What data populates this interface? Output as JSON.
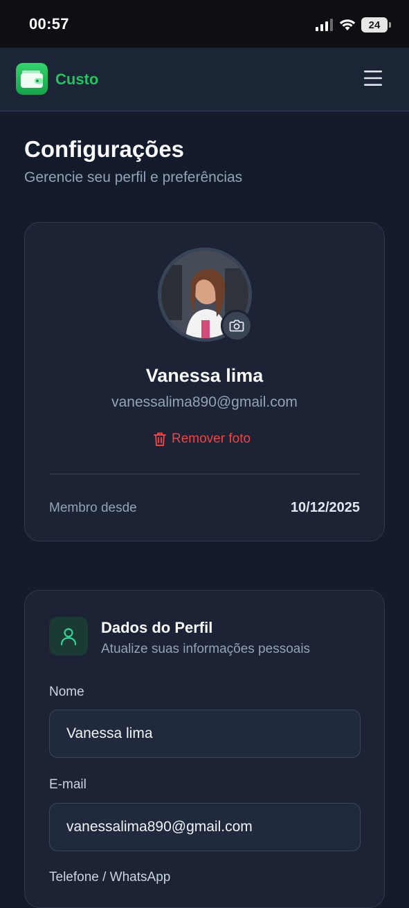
{
  "status_bar": {
    "time": "00:57",
    "battery": "24",
    "battery_level": 0.24
  },
  "header": {
    "brand": "Custo"
  },
  "page": {
    "title": "Configurações",
    "subtitle": "Gerencie seu perfil e preferências"
  },
  "profile": {
    "name": "Vanessa lima",
    "email": "vanessalima890@gmail.com",
    "remove_photo_label": "Remover foto",
    "member_since_label": "Membro desde",
    "member_since_value": "10/12/2025"
  },
  "profile_data": {
    "title": "Dados do Perfil",
    "subtitle": "Atualize suas informações pessoais",
    "name_label": "Nome",
    "name_value": "Vanessa lima",
    "email_label": "E-mail",
    "email_value": "vanessalima890@gmail.com",
    "phone_label": "Telefone / WhatsApp"
  },
  "colors": {
    "accent": "#22c55e",
    "danger": "#ef4444",
    "background": "#141c2b"
  }
}
